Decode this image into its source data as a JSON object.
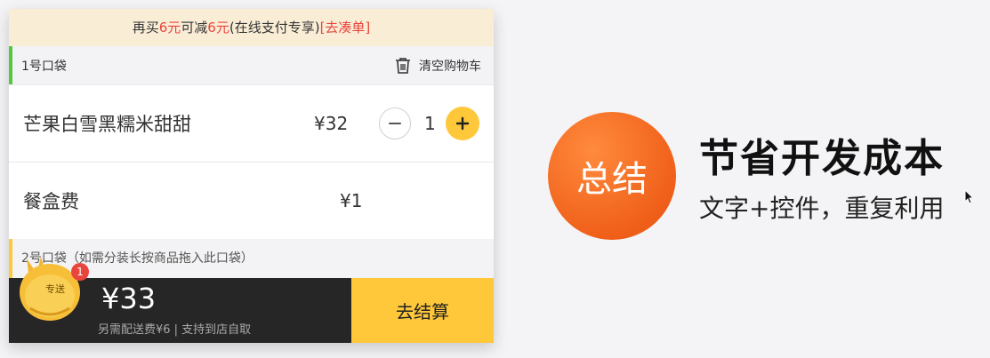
{
  "banner": {
    "prefix": "再买",
    "amount1": "6元",
    "middle": "可减",
    "amount2": "6元",
    "suffix": "(在线支付专享)",
    "link": "[去凑单]"
  },
  "bag1": {
    "title": "1号口袋",
    "clear_label": "清空购物车",
    "clear_icon": "trash-icon"
  },
  "item": {
    "name": "芒果白雪黑糯米甜甜",
    "price": "¥32",
    "quantity": "1"
  },
  "fee": {
    "name": "餐盒费",
    "price": "¥1"
  },
  "bag2": {
    "title": "2号口袋（如需分装长按商品拖入此口袋）"
  },
  "bottom": {
    "badge_count": "1",
    "mascot_label": "专送",
    "total": "¥33",
    "note": "另需配送费¥6 | 支持到店自取",
    "checkout_label": "去结算"
  },
  "summary": {
    "circle_label": "总结",
    "headline": "节省开发成本",
    "subline": "文字+控件，重复利用"
  },
  "colors": {
    "accent_yellow": "#ffc83a",
    "accent_red": "#e8453c",
    "bag1_green": "#52c93f",
    "summary_orange": "#f0601a"
  }
}
